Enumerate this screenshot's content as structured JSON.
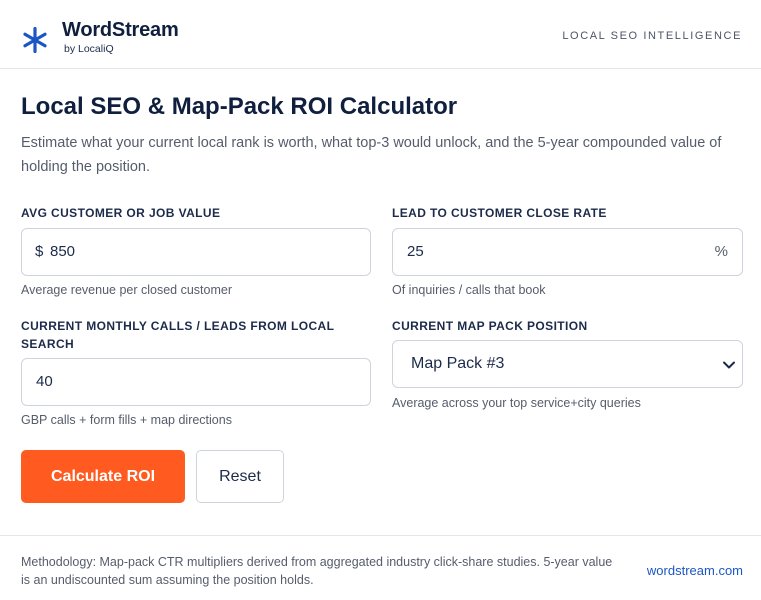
{
  "header": {
    "brand_name": "WordStream",
    "brand_sub": "by LocaliQ",
    "tagline": "LOCAL SEO INTELLIGENCE",
    "logo_icon": "asterisk-icon",
    "accent_color": "#1a56c4"
  },
  "main": {
    "title": "Local SEO & Map-Pack ROI Calculator",
    "subtitle": "Estimate what your current local rank is worth, what top-3 would unlock, and the 5-year compounded value of holding the position."
  },
  "fields": {
    "customer_value": {
      "label": "AVG CUSTOMER OR JOB VALUE",
      "prefix": "$",
      "value": "850",
      "hint": "Average revenue per closed customer"
    },
    "close_rate": {
      "label": "LEAD TO CUSTOMER CLOSE RATE",
      "value": "25",
      "suffix": "%",
      "hint": "Of inquiries / calls that book"
    },
    "monthly_leads": {
      "label": "CURRENT MONTHLY CALLS / LEADS FROM LOCAL SEARCH",
      "value": "40",
      "hint": "GBP calls + form fills + map directions"
    },
    "map_position": {
      "label": "CURRENT MAP PACK POSITION",
      "selected": "Map Pack #3",
      "hint": "Average across your top service+city queries"
    }
  },
  "buttons": {
    "calculate": "Calculate ROI",
    "reset": "Reset",
    "primary_color": "#ff5a1f"
  },
  "footer": {
    "methodology": "Methodology: Map-pack CTR multipliers derived from aggregated industry click-share studies. 5-year value is an undiscounted sum assuming the position holds.",
    "link": "wordstream.com"
  }
}
